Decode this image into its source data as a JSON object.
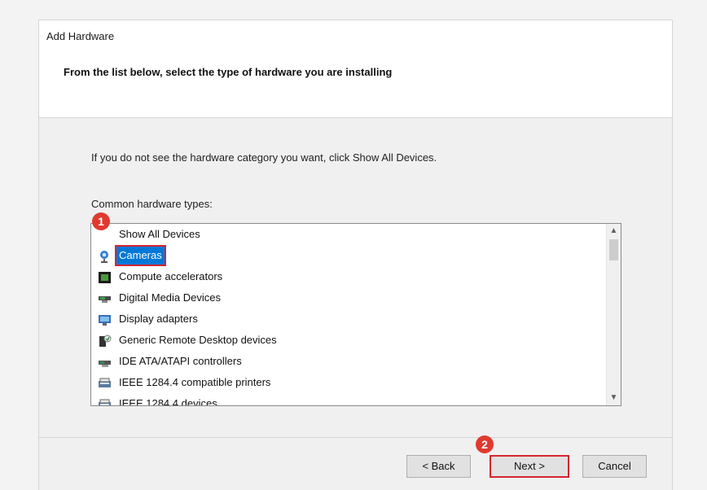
{
  "dialog": {
    "title": "Add Hardware",
    "instruction": "From the list below, select the type of hardware you are installing",
    "hint": "If you do not see the hardware category you want, click Show All Devices.",
    "list_label": "Common hardware types:",
    "items": [
      {
        "label": "Show All Devices",
        "icon": "show-all-devices-icon"
      },
      {
        "label": "Cameras",
        "icon": "camera-icon",
        "selected": true
      },
      {
        "label": "Compute accelerators",
        "icon": "compute-accelerator-icon"
      },
      {
        "label": "Digital Media Devices",
        "icon": "digital-media-icon"
      },
      {
        "label": "Display adapters",
        "icon": "display-adapter-icon"
      },
      {
        "label": "Generic Remote Desktop devices",
        "icon": "remote-desktop-icon"
      },
      {
        "label": "IDE ATA/ATAPI controllers",
        "icon": "ide-controller-icon"
      },
      {
        "label": "IEEE 1284.4 compatible printers",
        "icon": "printer-port-icon"
      },
      {
        "label": "IEEE 1284.4 devices",
        "icon": "printer-port-icon"
      }
    ],
    "buttons": {
      "back": "< Back",
      "next": "Next >",
      "cancel": "Cancel"
    },
    "annotations": {
      "step1": "1",
      "step2": "2",
      "accent": "#e03a30"
    },
    "colors": {
      "selection": "#0078d7",
      "highlight_border": "#d7262e"
    }
  }
}
